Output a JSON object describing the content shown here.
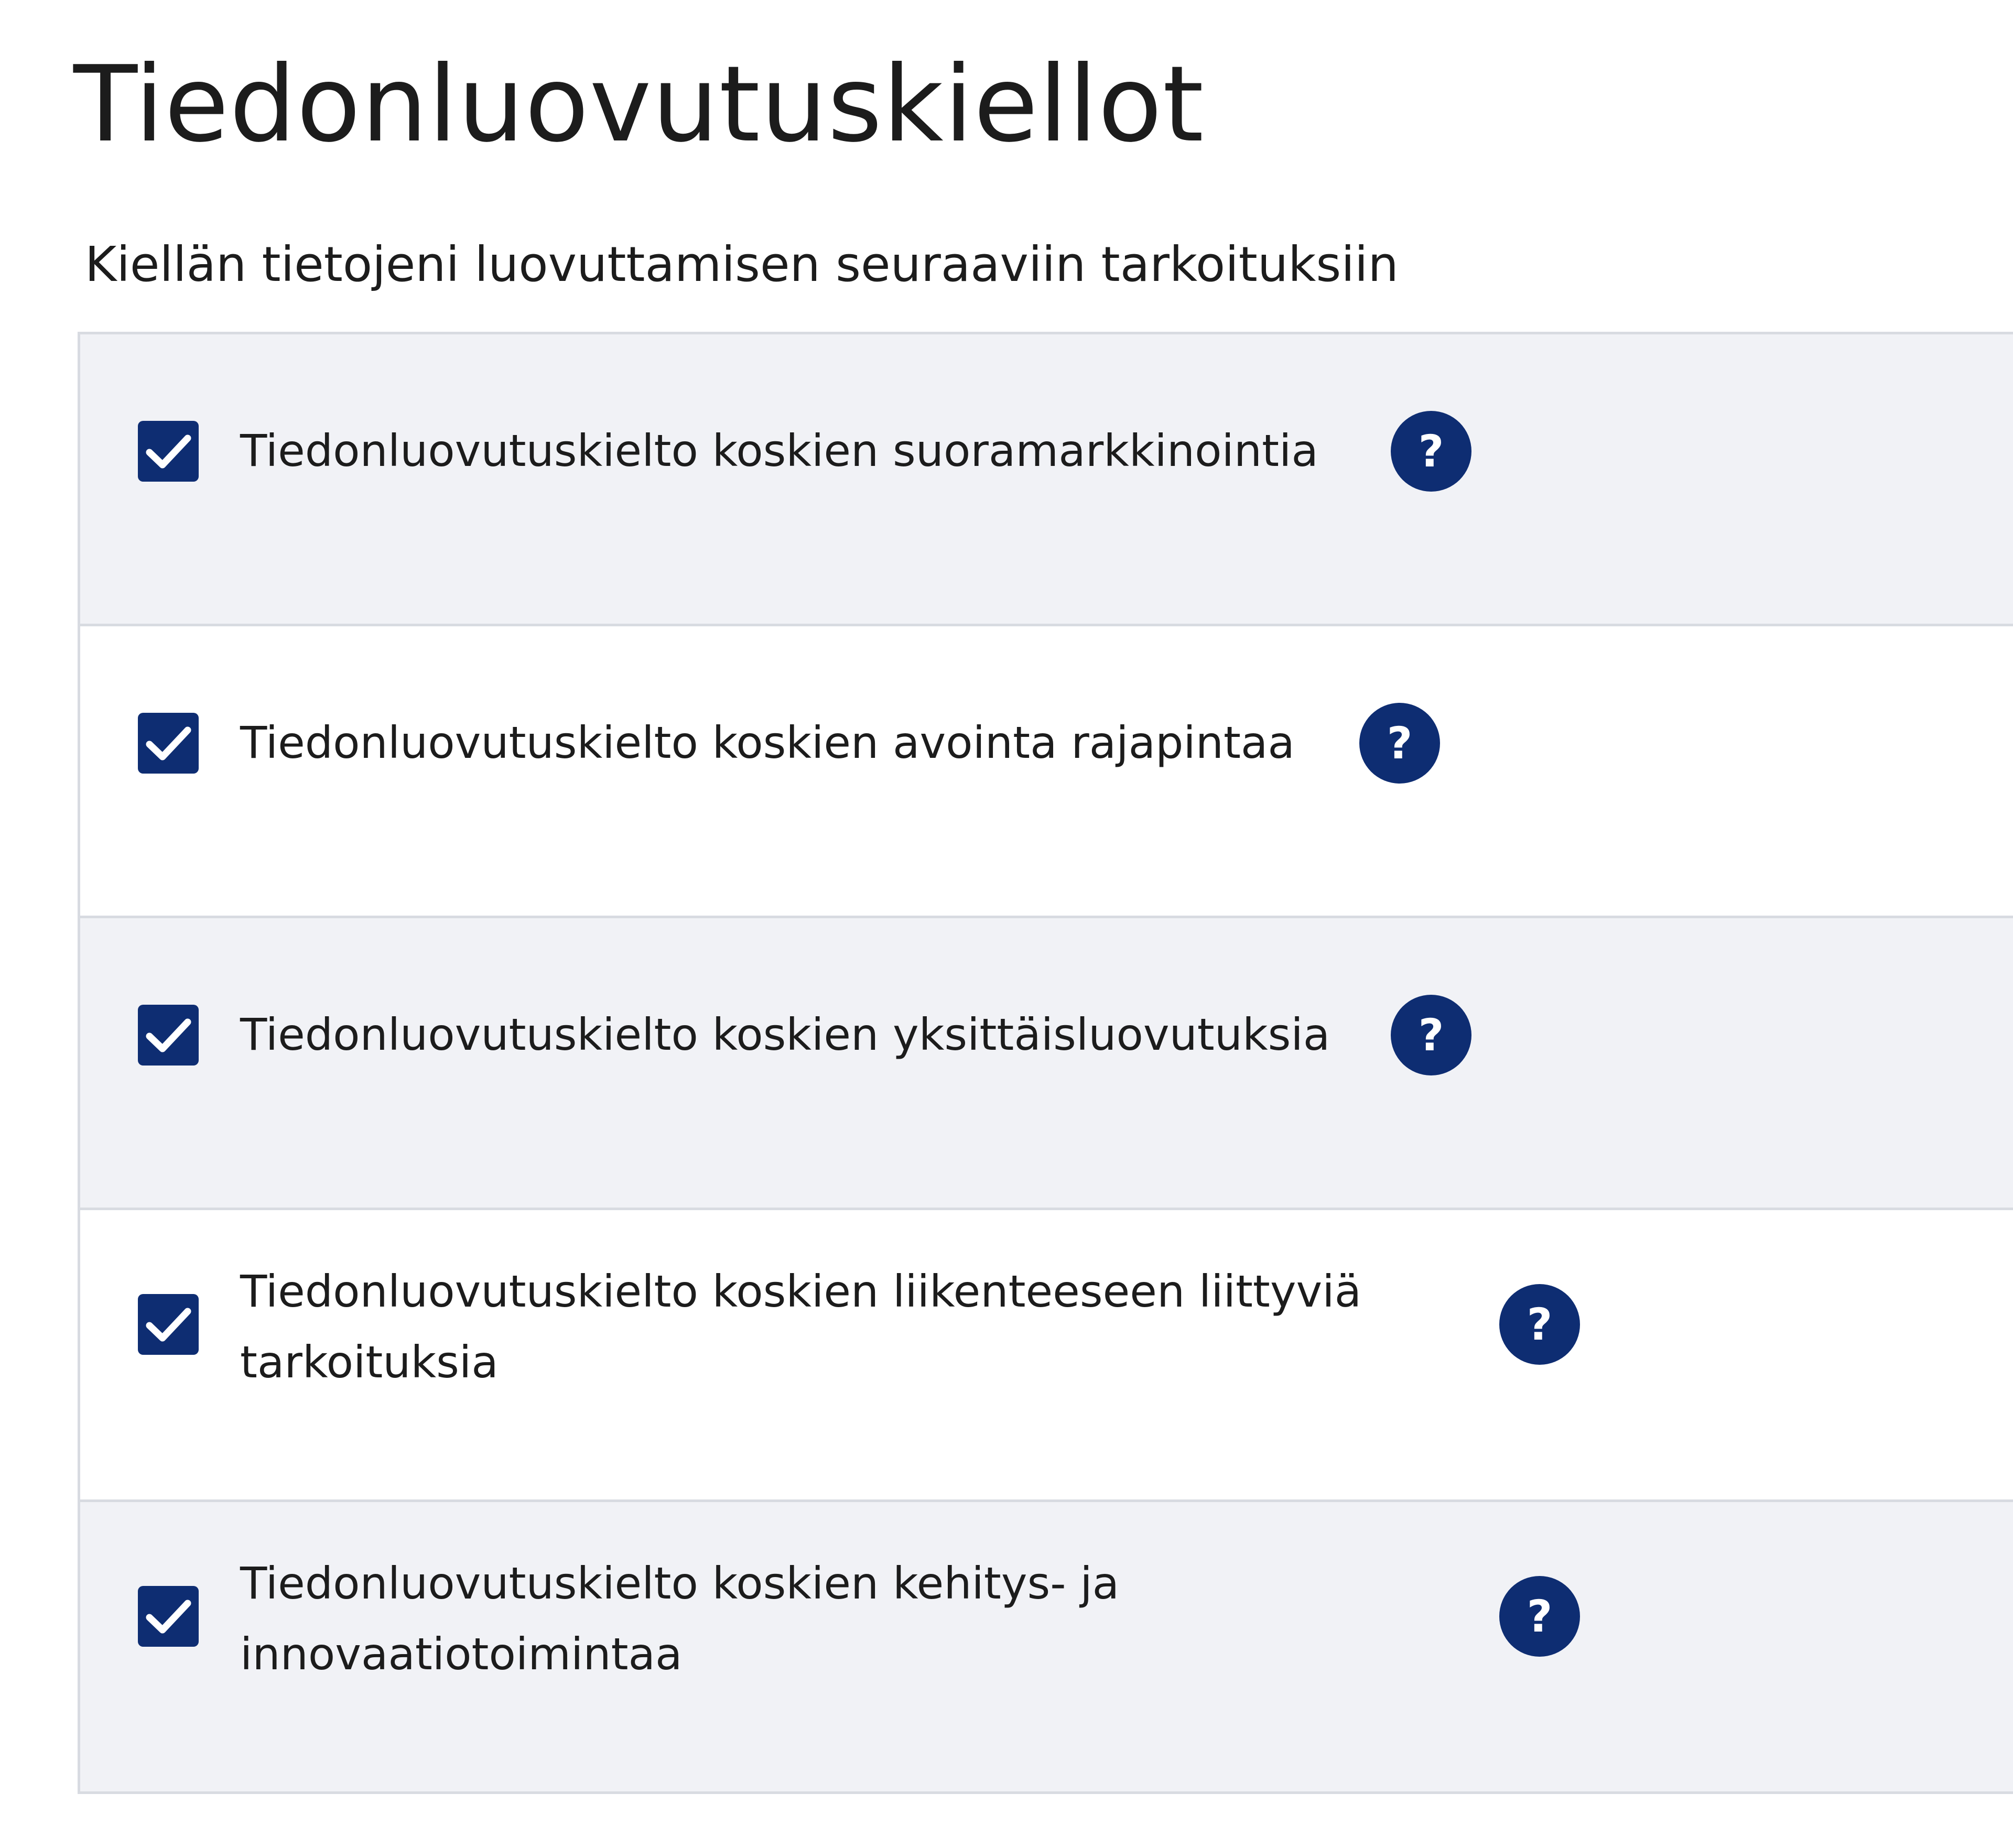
{
  "page": {
    "title": "Tiedonluovutuskiellot",
    "section_label": "Kiellän tietojeni luovuttamisen seuraaviin tarkoituksiin"
  },
  "options": [
    {
      "label": "Tiedonluovutuskielto koskien suoramarkkinointia",
      "checked": true,
      "help_icon": "?"
    },
    {
      "label": "Tiedonluovutuskielto koskien avointa rajapintaa",
      "checked": true,
      "help_icon": "?"
    },
    {
      "label": "Tiedonluovutuskielto koskien yksittäisluovutuksia",
      "checked": true,
      "help_icon": "?"
    },
    {
      "label": "Tiedonluovutuskielto koskien liikenteeseen liittyviä tarkoituksia",
      "checked": true,
      "help_icon": "?"
    },
    {
      "label": "Tiedonluovutuskielto koskien kehitys- ja innovaatiotoimintaa",
      "checked": true,
      "help_icon": "?"
    }
  ],
  "colors": {
    "accent": "#0e2d72",
    "row_shaded": "#f1f2f6",
    "row_plain": "#ffffff",
    "divider": "#d8dbe1"
  },
  "icons": {
    "checkbox": "checkmark-icon",
    "help": "question-mark-icon"
  }
}
